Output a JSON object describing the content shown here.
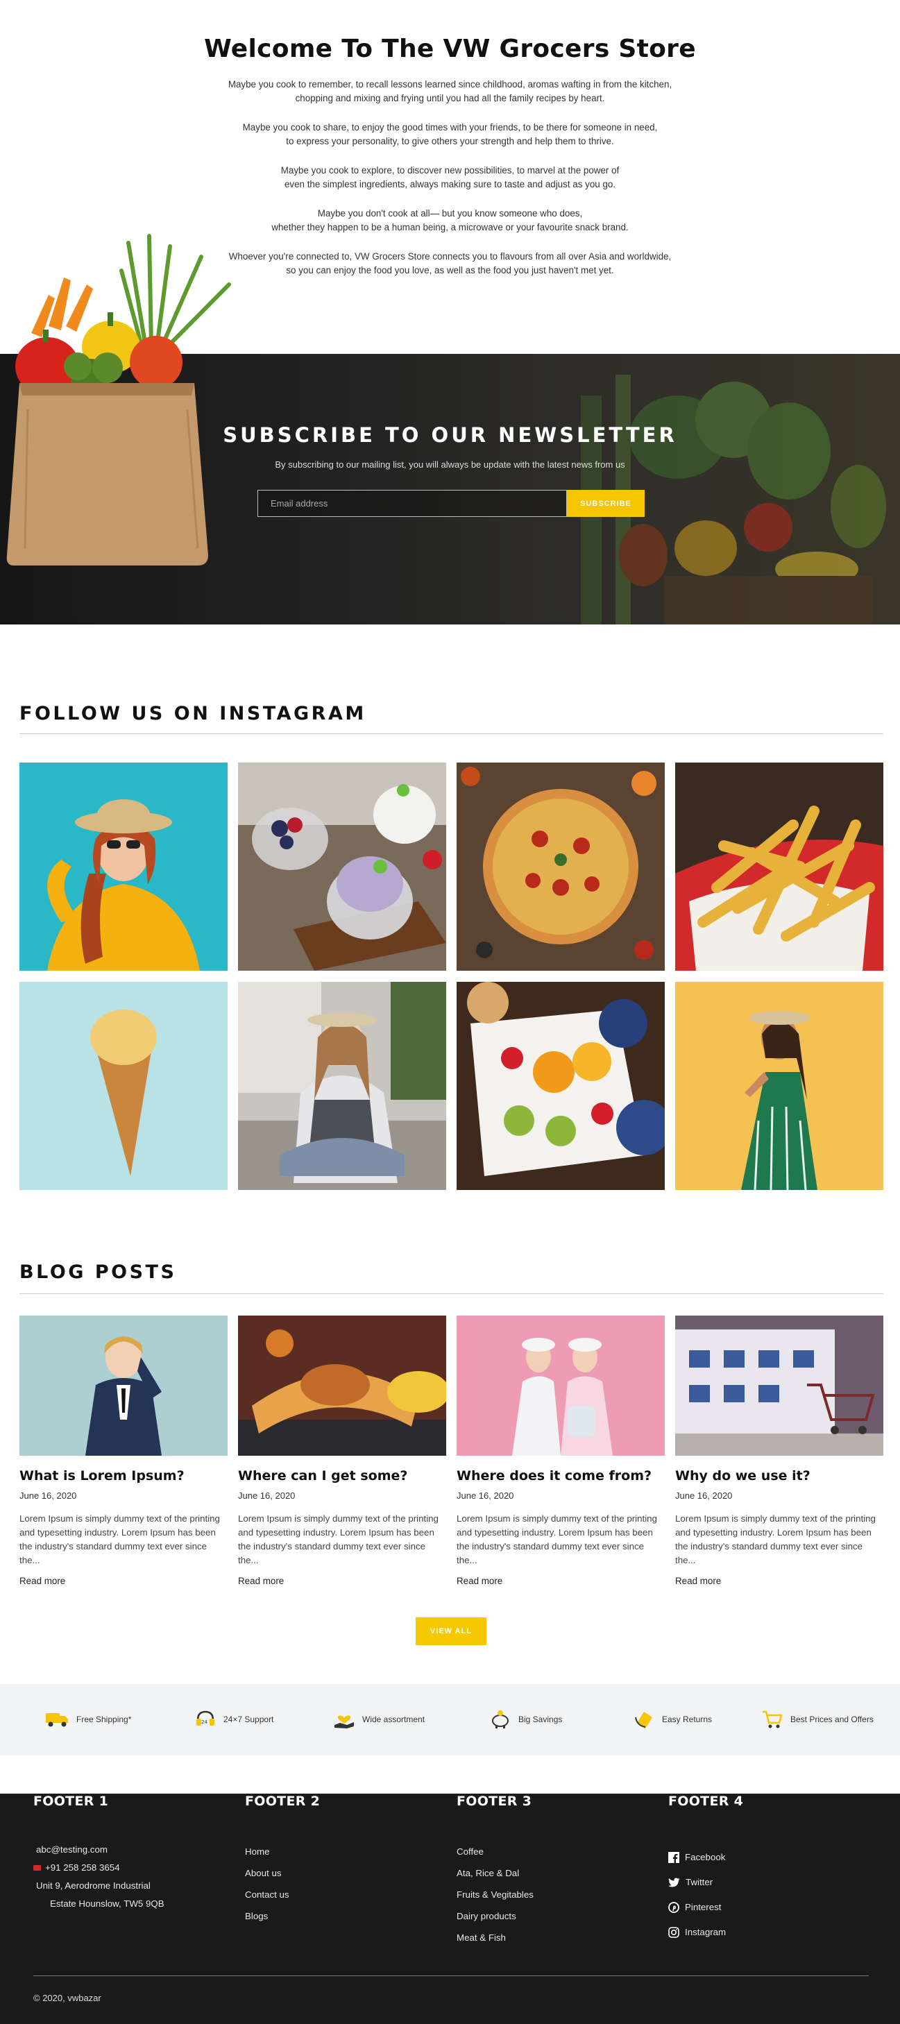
{
  "welcome": {
    "title": "Welcome To The VW Grocers Store",
    "paragraphs": [
      "Maybe you cook to remember, to recall lessons learned since childhood, aromas wafting in from the kitchen,\nchopping and mixing and frying until you had all the family recipes by heart.",
      "Maybe you cook to share, to enjoy the good times with your friends, to be there for someone in need,\nto express your personality, to give others your strength and help them to thrive.",
      "Maybe you cook to explore, to discover new possibilities, to marvel at the power of\neven the simplest ingredients, always making sure to taste and adjust as you go.",
      "Maybe you don't cook at all— but you know someone who does,\nwhether they happen to be a human being, a microwave or your favourite snack brand.",
      "Whoever you're connected to, VW Grocers Store connects you to flavours from all over Asia and worldwide,\nso you can enjoy the food you love, as well as the food you just haven't met yet."
    ]
  },
  "newsletter": {
    "title": "SUBSCRIBE TO OUR NEWSLETTER",
    "subtitle": "By subscribing to our mailing list, you will always be update with the latest news from us",
    "email_placeholder": "Email address",
    "button_label": "SUBSCRIBE"
  },
  "instagram": {
    "title": "FOLLOW US ON INSTAGRAM",
    "tiles": [
      "woman-in-yellow-sweater",
      "berries-and-ice-cream",
      "pizza",
      "french-fries",
      "ice-cream-cone",
      "woman-crouching",
      "fruit-platter",
      "woman-in-green-dress"
    ]
  },
  "blog": {
    "title": "BLOG POSTS",
    "posts": [
      {
        "title": "What is Lorem Ipsum?",
        "date": "June 16, 2020",
        "excerpt": "Lorem Ipsum is simply dummy text of the printing and typesetting industry. Lorem Ipsum has been the industry's standard dummy text ever since the...",
        "read_more": "Read more"
      },
      {
        "title": "Where can I get some?",
        "date": "June 16, 2020",
        "excerpt": "Lorem Ipsum is simply dummy text of the printing and typesetting industry. Lorem Ipsum has been the industry's standard dummy text ever since the...",
        "read_more": "Read more"
      },
      {
        "title": "Where does it come from?",
        "date": "June 16, 2020",
        "excerpt": "Lorem Ipsum is simply dummy text of the printing and typesetting industry. Lorem Ipsum has been the industry's standard dummy text ever since the...",
        "read_more": "Read more"
      },
      {
        "title": "Why do we use it?",
        "date": "June 16, 2020",
        "excerpt": "Lorem Ipsum is simply dummy text of the printing and typesetting industry. Lorem Ipsum has been the industry's standard dummy text ever since the...",
        "read_more": "Read more"
      }
    ],
    "view_all": "VIEW ALL"
  },
  "features": [
    {
      "label": "Free Shipping*",
      "icon": "truck-icon"
    },
    {
      "label": "24×7 Support",
      "icon": "headset-icon"
    },
    {
      "label": "Wide assortment",
      "icon": "hand-heart-icon"
    },
    {
      "label": "Big Savings",
      "icon": "piggy-bank-icon"
    },
    {
      "label": "Easy Returns",
      "icon": "return-box-icon"
    },
    {
      "label": "Best Prices and Offers",
      "icon": "cart-icon"
    }
  ],
  "footer": {
    "col1": {
      "title": "FOOTER 1",
      "email": "abc@testing.com",
      "phone": "+91 258 258 3654",
      "address_line1": "Unit 9, Aerodrome Industrial",
      "address_line2": "Estate Hounslow, TW5 9QB"
    },
    "col2": {
      "title": "FOOTER 2",
      "links": [
        "Home",
        "About us",
        "Contact us",
        "Blogs"
      ]
    },
    "col3": {
      "title": "FOOTER 3",
      "links": [
        "Coffee",
        "Ata, Rice & Dal",
        "Fruits & Vegitables",
        "Dairy products",
        "Meat & Fish"
      ]
    },
    "col4": {
      "title": "FOOTER 4",
      "links": [
        "Facebook",
        "Twitter",
        "Pinterest",
        "Instagram"
      ]
    },
    "copyright": "© 2020, vwbazar"
  },
  "colors": {
    "accent": "#f7c500",
    "footer_bg": "#1a1a1a",
    "features_bg": "#f3f4f5"
  }
}
